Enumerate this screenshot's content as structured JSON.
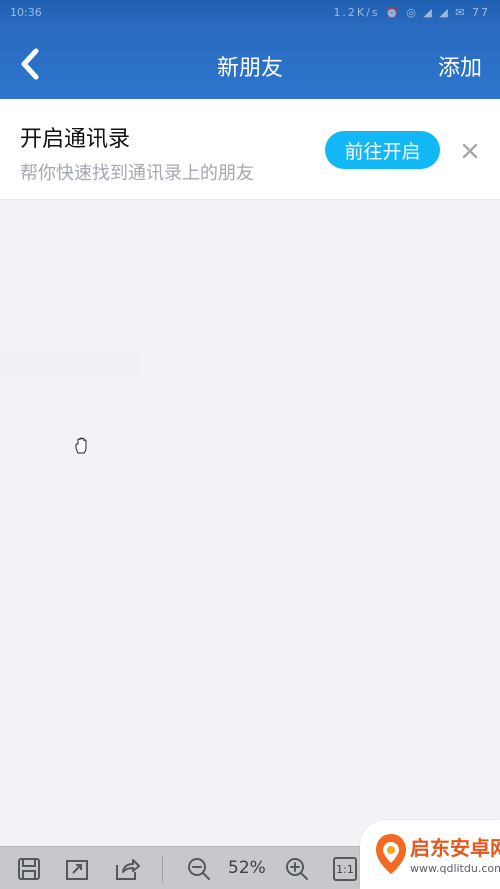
{
  "status_bar": {
    "time": "10:36",
    "right_text": "1.2K/s ⏰ ◎ ◢ ◢ ✉ 77"
  },
  "nav": {
    "title": "新朋友",
    "add_label": "添加",
    "back_icon": "chevron-left-icon"
  },
  "contacts_banner": {
    "title": "开启通讯录",
    "subtitle": "帮你快速找到通讯录上的朋友",
    "go_button_label": "前往开启",
    "close_icon": "close-icon"
  },
  "viewer_toolbar": {
    "zoom_label": "52%",
    "ratio_label": "1:1",
    "icons": [
      "save-icon",
      "fit-window-icon",
      "share-icon",
      "zoom-out-icon",
      "zoom-in-icon"
    ]
  },
  "watermark": {
    "name": "启东安卓网",
    "url": "www.qdlitdu.com"
  },
  "colors": {
    "header_blue": "#2c75cc",
    "accent_button": "#12b7f5",
    "background": "#f2f3f7",
    "watermark_orange": "#e5571c"
  }
}
